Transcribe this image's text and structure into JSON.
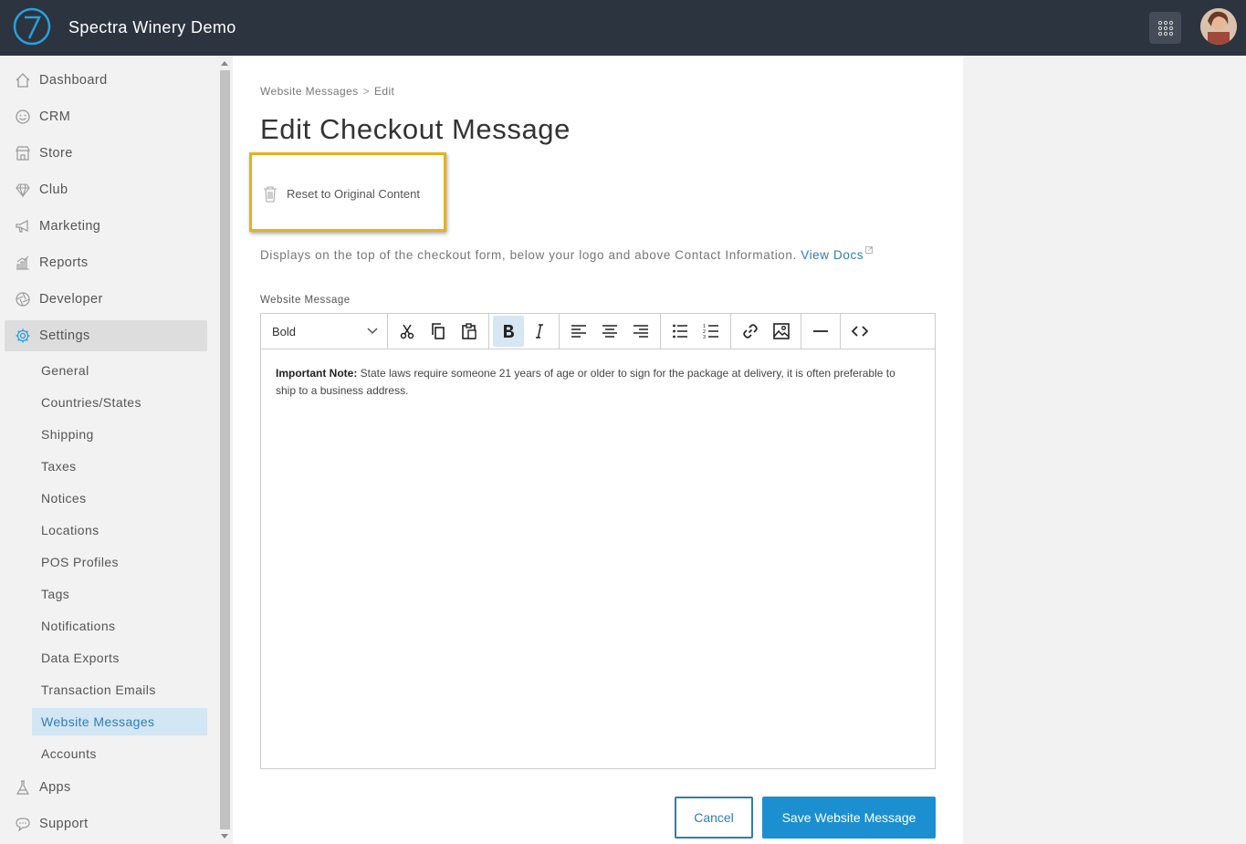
{
  "header": {
    "app_title": "Spectra Winery Demo",
    "logo_text": "7"
  },
  "sidebar": {
    "items": [
      {
        "label": "Dashboard",
        "icon": "home-icon"
      },
      {
        "label": "CRM",
        "icon": "smile-icon"
      },
      {
        "label": "Store",
        "icon": "storefront-icon"
      },
      {
        "label": "Club",
        "icon": "diamond-icon"
      },
      {
        "label": "Marketing",
        "icon": "megaphone-icon"
      },
      {
        "label": "Reports",
        "icon": "bar-chart-icon"
      },
      {
        "label": "Developer",
        "icon": "aperture-icon"
      },
      {
        "label": "Settings",
        "icon": "gear-icon"
      },
      {
        "label": "Apps",
        "icon": "flask-icon"
      },
      {
        "label": "Support",
        "icon": "chat-icon"
      }
    ],
    "settings_sub": [
      "General",
      "Countries/States",
      "Shipping",
      "Taxes",
      "Notices",
      "Locations",
      "POS Profiles",
      "Tags",
      "Notifications",
      "Data Exports",
      "Transaction Emails",
      "Website Messages",
      "Accounts"
    ]
  },
  "main": {
    "breadcrumb": {
      "parent": "Website Messages",
      "separator": ">",
      "current": "Edit"
    },
    "title": "Edit Checkout Message",
    "reset_label": "Reset to Original Content",
    "description": "Displays on the top of the checkout form, below your logo and above Contact Information.",
    "view_docs": "View Docs",
    "field_label": "Website Message",
    "editor": {
      "format_select": "Bold",
      "content_bold": "Important Note:",
      "content_text": " State laws require someone 21 years of age or older to sign for the package at delivery, it is often preferable to ship to a business address."
    },
    "cancel_label": "Cancel",
    "save_label": "Save Website Message"
  },
  "colors": {
    "topbar": "#2c3440",
    "accent": "#2f7db5",
    "primary_button": "#1c8fd0",
    "highlight": "#e5b21b"
  }
}
